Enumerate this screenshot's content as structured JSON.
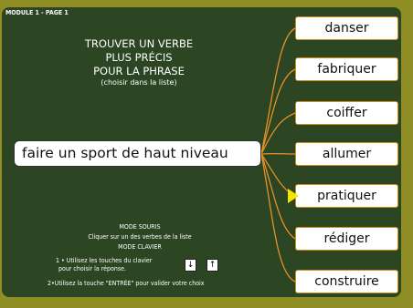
{
  "module_label": "MODULE 1 - PAGE 1",
  "title": {
    "line1": "TROUVER UN VERBE",
    "line2": "PLUS PRÉCIS",
    "line3": "POUR LA PHRASE",
    "sub": "(choisir dans la liste)"
  },
  "phrase": "faire un sport de haut niveau",
  "choices": [
    "danser",
    "fabriquer",
    "coiffer",
    "allumer",
    "pratiquer",
    "rédiger",
    "construire"
  ],
  "selected_choice": "pratiquer",
  "instructions": {
    "mode_souris": "MODE SOURIS",
    "souris_text": "Cliquer sur un des verbes de la liste",
    "mode_clavier": "MODE CLAVIER",
    "step1_line1": "1 • Utilisez les touches du clavier",
    "step1_line2": "pour choisir la réponse.",
    "step2": "2•Utilisez la touche \"ENTRÉE\" pour valider votre choix"
  },
  "keys": {
    "down": "↓",
    "up": "↑"
  },
  "colors": {
    "background": "#8e8e25",
    "board": "#2c4522",
    "choice_border": "#d58c15",
    "connector": "#e8912a",
    "pointer": "#f2e600"
  }
}
